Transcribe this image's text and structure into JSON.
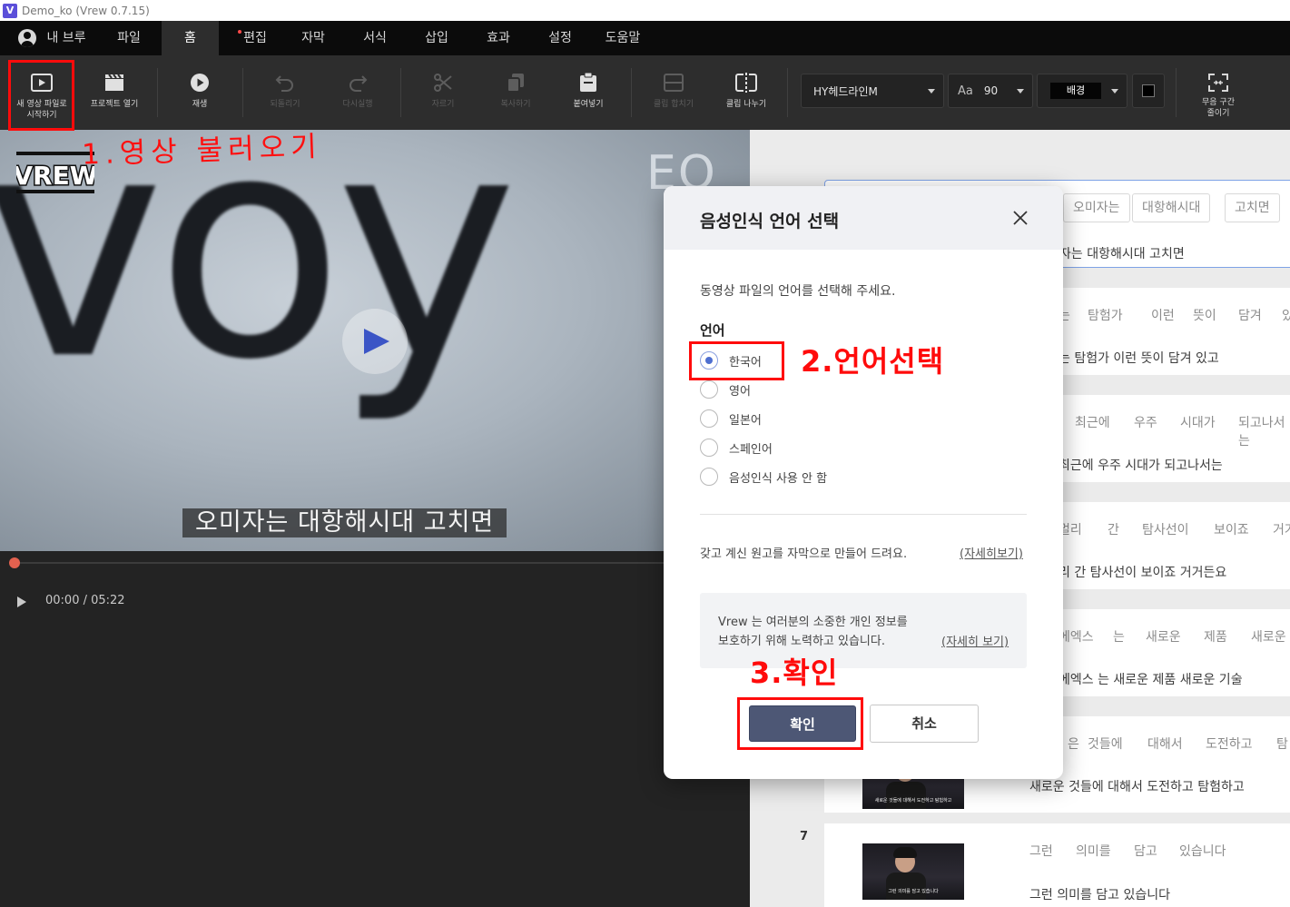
{
  "window": {
    "title": "Demo_ko (Vrew 0.7.15)",
    "logo_letter": "V"
  },
  "menu": {
    "user_label": "내 브루",
    "items": [
      "파일",
      "홈",
      "편집",
      "자막",
      "서식",
      "삽입",
      "효과",
      "설정",
      "도움말"
    ],
    "active": "홈"
  },
  "toolbar": {
    "new_project": "새 영상 파일로\n시작하기",
    "open_project": "프로젝트 열기",
    "play": "재생",
    "undo": "되돌리기",
    "redo": "다시실행",
    "cut": "자르기",
    "copy": "복사하기",
    "paste": "붙여넣기",
    "merge_clip": "클립 합치기",
    "split_clip": "클립 나누기",
    "font_name": "HY헤드라인M",
    "font_size_icon": "Aa",
    "font_size": "90",
    "background_label": "배경",
    "silence": "무음 구간\n줄이기"
  },
  "video": {
    "big_text": "voy",
    "logo_text": "EO",
    "watermark": "VREW",
    "subtitle": "오미자는 대항해시대 고치면",
    "time": "00:00 / 05:22",
    "progress": 0.0
  },
  "transcript": {
    "first": {
      "chips": [
        "오미자는",
        "대항해시대",
        "고치면"
      ],
      "sentence": "자는 대항해시대 고치면"
    },
    "rows": [
      {
        "words": [
          "는",
          "탐험가",
          "이런",
          "뜻이",
          "담겨",
          "있"
        ],
        "sentence": "는 탐험가 이런 뜻이 담겨 있고"
      },
      {
        "words": [
          "최근에",
          "우주",
          "시대가",
          "되고나서는"
        ],
        "sentence": "최근에 우주 시대가 되고나서는"
      },
      {
        "words": [
          "멀리",
          "간",
          "탐사선이",
          "보이죠",
          "거거"
        ],
        "sentence": "리 간 탐사선이 보이죠 거거든요"
      },
      {
        "words": [
          "에엑스",
          "는",
          "새로운",
          "제품",
          "새로운"
        ],
        "sentence": "에엑스 는 새로운 제품 새로운 기술"
      },
      {
        "words": [
          "은",
          "것들에",
          "대해서",
          "도전하고",
          "탐"
        ],
        "sentence": "새로운 것들에 대해서 도전하고 탐험하고"
      }
    ],
    "row7": {
      "number": "7",
      "words": [
        "그런",
        "의미를",
        "담고",
        "있습니다"
      ],
      "sentence": "그런 의미를 담고 있습니다",
      "thumb_caption": "그런 의미를 담고 있습니다",
      "thumb6_caption": "새로운 것들에 대해서 도전하고 탐험하고"
    }
  },
  "dialog": {
    "title": "음성인식 언어 선택",
    "description": "동영상 파일의 언어를 선택해 주세요.",
    "language_label": "언어",
    "options": [
      "한국어",
      "영어",
      "일본어",
      "스페인어",
      "음성인식 사용 안 함"
    ],
    "selected": "한국어",
    "script_text": "갖고 계신 원고를 자막으로 만들어 드려요.",
    "script_link": "(자세히보기)",
    "privacy_line1": "Vrew 는 여러분의 소중한 개인 정보를",
    "privacy_line2": "보호하기 위해 노력하고 있습니다.",
    "privacy_link": "(자세히 보기)",
    "ok": "확인",
    "cancel": "취소"
  },
  "annotations": {
    "step1": "1.영상 불러오기",
    "step2": "2.언어선택",
    "step3": "3.확인",
    "color": "#ff0b0b"
  }
}
